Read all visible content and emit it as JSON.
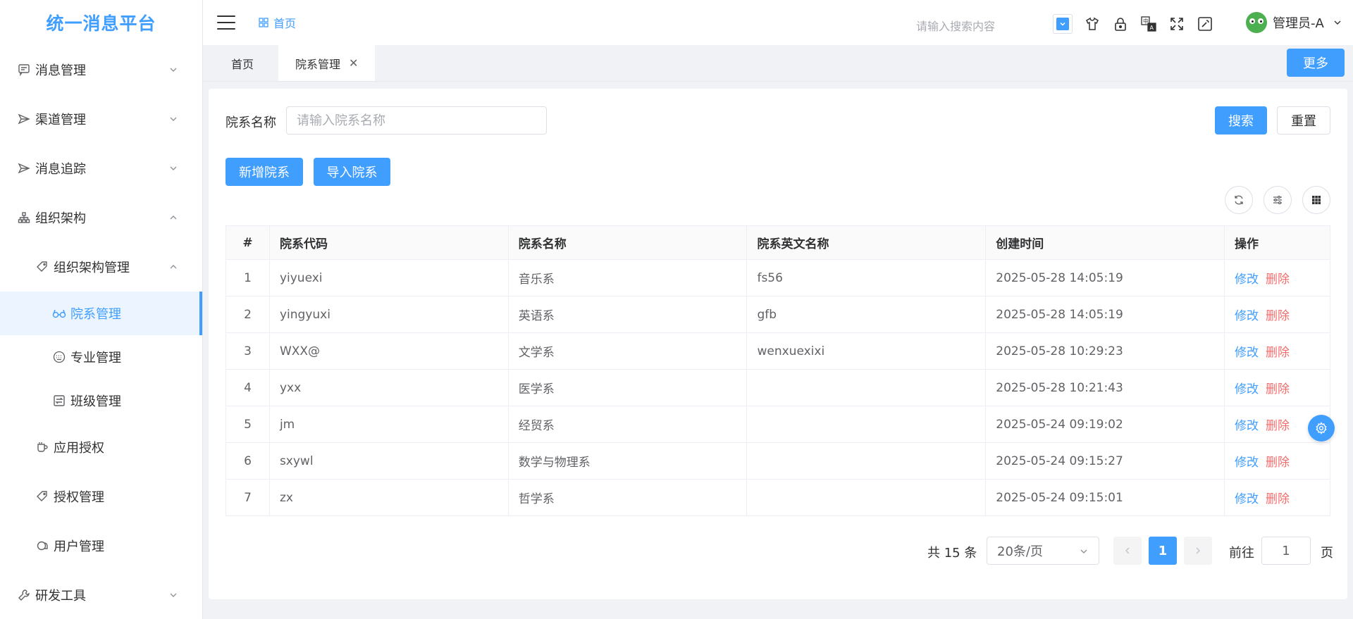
{
  "app": {
    "title": "统一消息平台"
  },
  "header": {
    "breadcrumb": "首页",
    "search_placeholder": "请输入搜索内容",
    "user_name": "管理员-A"
  },
  "sidebar": {
    "items": [
      {
        "label": "消息管理",
        "icon": "message-icon",
        "expanded": false
      },
      {
        "label": "渠道管理",
        "icon": "send-icon",
        "expanded": false
      },
      {
        "label": "消息追踪",
        "icon": "send-icon",
        "expanded": false
      },
      {
        "label": "组织架构",
        "icon": "org-icon",
        "expanded": true
      },
      {
        "label": "组织架构管理",
        "icon": "tag-icon",
        "expanded": true
      },
      {
        "label": "院系管理",
        "icon": "glasses-icon",
        "active": true
      },
      {
        "label": "专业管理",
        "icon": "keyboard-icon"
      },
      {
        "label": "班级管理",
        "icon": "switch-icon"
      },
      {
        "label": "应用授权",
        "icon": "coffee-icon"
      },
      {
        "label": "授权管理",
        "icon": "tag-icon"
      },
      {
        "label": "用户管理",
        "icon": "user-icon"
      },
      {
        "label": "研发工具",
        "icon": "tool-icon",
        "expanded": false
      }
    ]
  },
  "tabs": [
    {
      "label": "首页",
      "active": false
    },
    {
      "label": "院系管理",
      "active": true
    }
  ],
  "tabbar": {
    "more_label": "更多"
  },
  "filter": {
    "label": "院系名称",
    "placeholder": "请输入院系名称",
    "search_label": "搜索",
    "reset_label": "重置"
  },
  "actions": {
    "add_label": "新增院系",
    "import_label": "导入院系"
  },
  "table": {
    "columns": [
      "#",
      "院系代码",
      "院系名称",
      "院系英文名称",
      "创建时间",
      "操作"
    ],
    "rows": [
      {
        "idx": "1",
        "code": "yiyuexi",
        "name": "音乐系",
        "en": "fs56",
        "time": "2025-05-28 14:05:19"
      },
      {
        "idx": "2",
        "code": "yingyuxi",
        "name": "英语系",
        "en": "gfb",
        "time": "2025-05-28 14:05:19"
      },
      {
        "idx": "3",
        "code": "WXX@",
        "name": "文学系",
        "en": "wenxuexixi",
        "time": "2025-05-28 10:29:23"
      },
      {
        "idx": "4",
        "code": "yxx",
        "name": "医学系",
        "en": "",
        "time": "2025-05-28 10:21:43"
      },
      {
        "idx": "5",
        "code": "jm",
        "name": "经贸系",
        "en": "",
        "time": "2025-05-24 09:19:02"
      },
      {
        "idx": "6",
        "code": "sxywl",
        "name": "数学与物理系",
        "en": "",
        "time": "2025-05-24 09:15:27"
      },
      {
        "idx": "7",
        "code": "zx",
        "name": "哲学系",
        "en": "",
        "time": "2025-05-24 09:15:01"
      }
    ],
    "edit_label": "修改",
    "delete_label": "删除"
  },
  "pagination": {
    "total_text": "共 15 条",
    "page_size": "20条/页",
    "current_page": "1",
    "goto_label": "前往",
    "goto_value": "1",
    "page_unit": "页"
  },
  "colors": {
    "primary": "#409eff",
    "danger": "#f56c6c"
  }
}
